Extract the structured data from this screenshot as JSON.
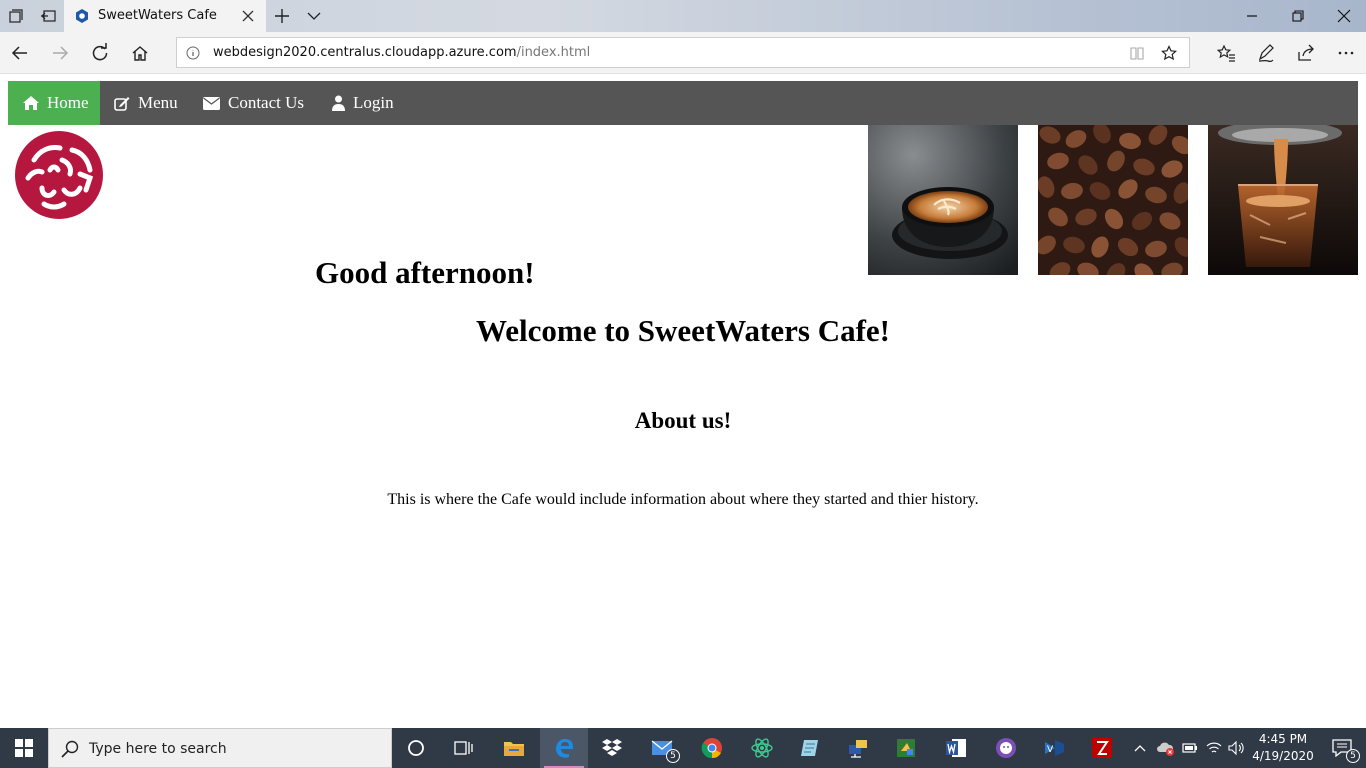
{
  "browser": {
    "tab_title": "SweetWaters Cafe",
    "url_host": "webdesign2020.centralus.cloudapp.azure.com",
    "url_path": "/index.html"
  },
  "site_nav": {
    "items": [
      {
        "label": "Home",
        "icon": "home-icon",
        "active": true
      },
      {
        "label": "Menu",
        "icon": "edit-icon",
        "active": false
      },
      {
        "label": "Contact Us",
        "icon": "envelope-icon",
        "active": false
      },
      {
        "label": "Login",
        "icon": "user-icon",
        "active": false
      }
    ],
    "active_color": "#4caf50",
    "bar_color": "#555555"
  },
  "content": {
    "greeting": "Good afternoon!",
    "welcome": "Welcome to SweetWaters Cafe!",
    "about_heading": "About us!",
    "about_text": "This is where the Cafe would include information about where they started and thier history."
  },
  "images": [
    "latte-cup-photo",
    "coffee-beans-photo",
    "espresso-pour-photo"
  ],
  "logo_color": "#b5173f",
  "taskbar": {
    "search_placeholder": "Type here to search",
    "mail_badge": "5",
    "time": "4:45 PM",
    "date": "4/19/2020",
    "notifications_badge": "5"
  }
}
